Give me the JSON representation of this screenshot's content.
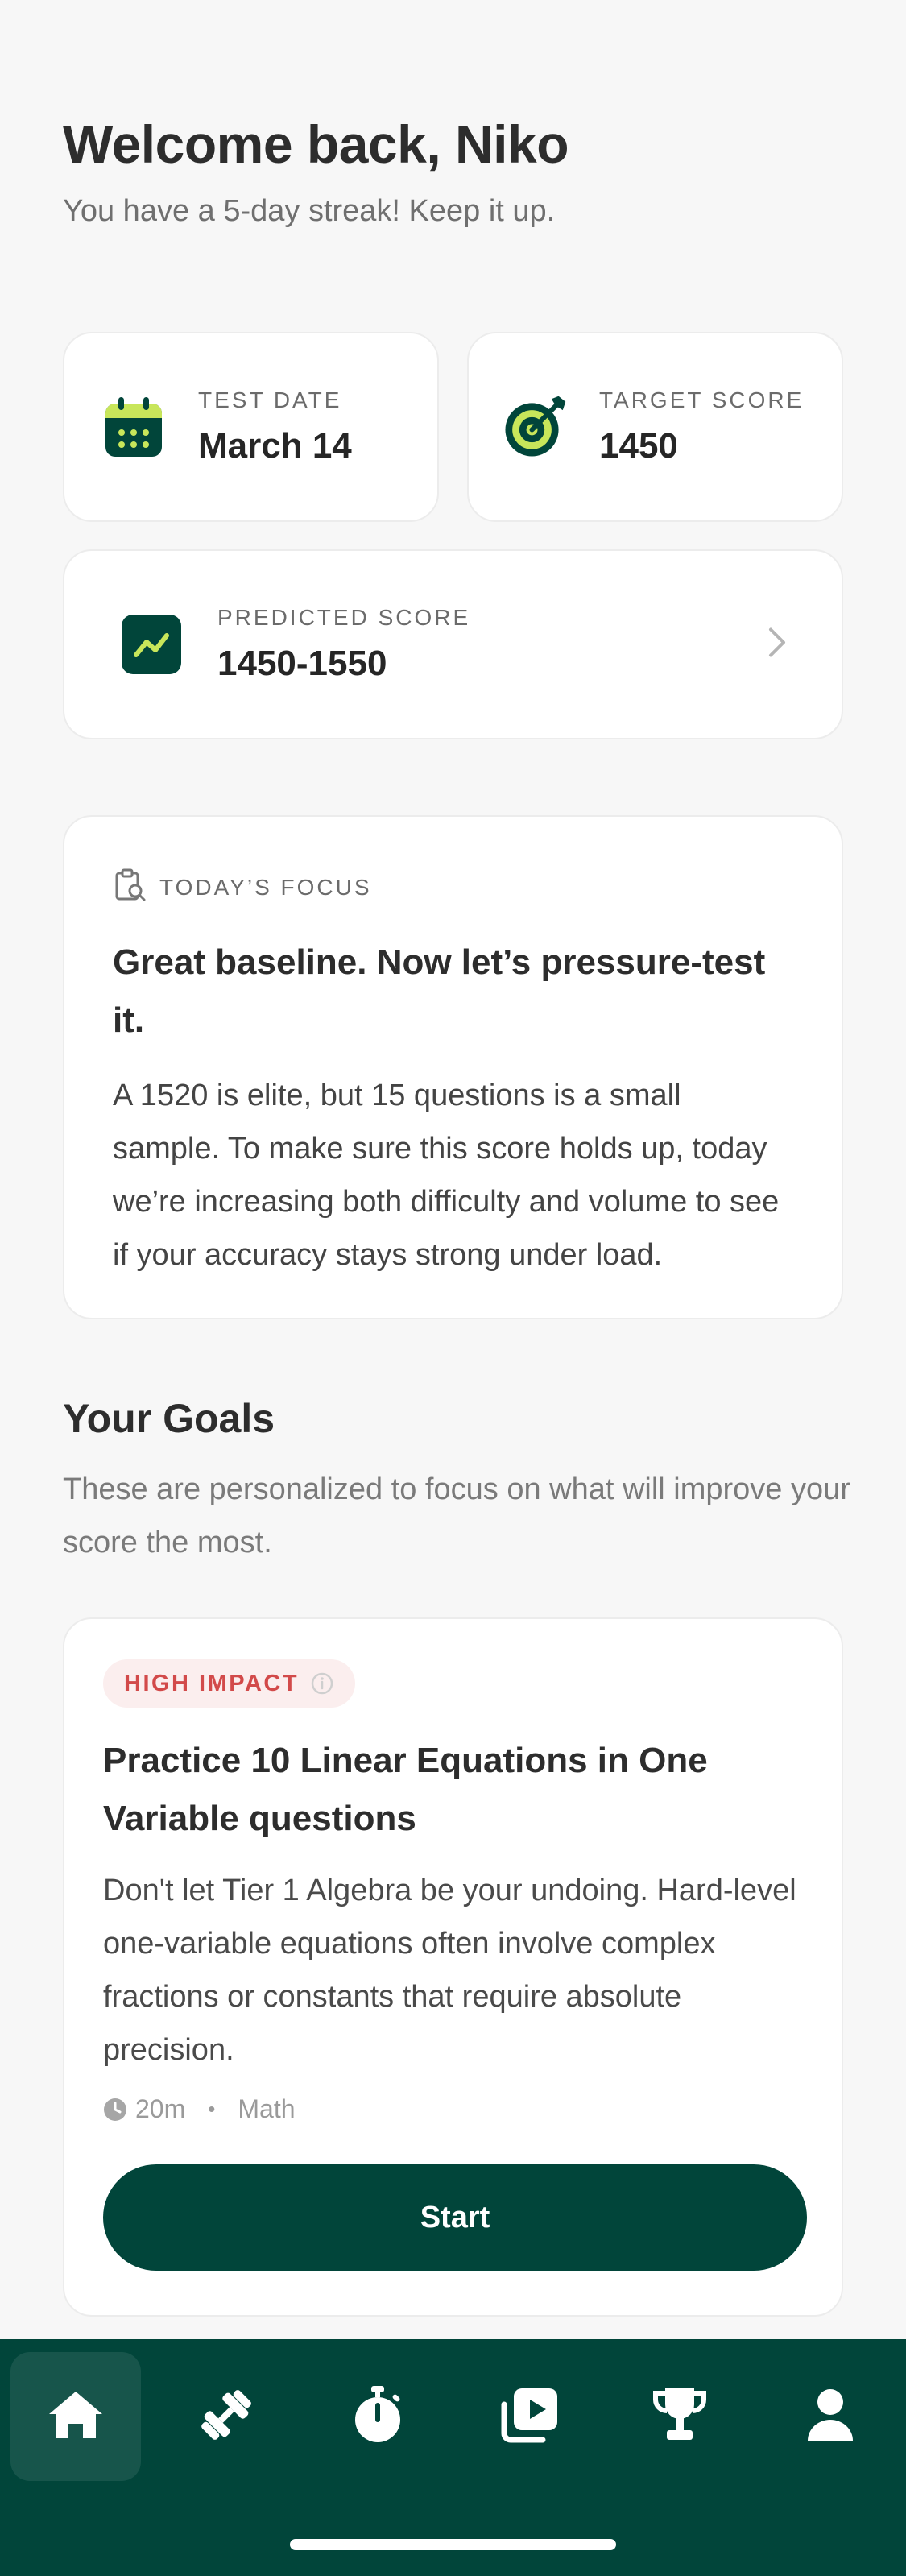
{
  "header": {
    "title": "Welcome back, Niko",
    "subtitle": "You have a 5-day streak! Keep it up."
  },
  "stats": {
    "test_date": {
      "label": "TEST DATE",
      "value": "March 14",
      "icon": "calendar-icon"
    },
    "target_score": {
      "label": "TARGET SCORE",
      "value": "1450",
      "icon": "target-icon"
    },
    "predicted_score": {
      "label": "PREDICTED SCORE",
      "value": "1450-1550",
      "icon": "trend-icon"
    }
  },
  "focus": {
    "label": "TODAY’S FOCUS",
    "title": "Great baseline. Now let’s pressure-test it.",
    "body": "A 1520 is elite, but 15 questions is a small sample. To make sure this score holds up, today we’re increasing both difficulty and volume to see if your accuracy stays strong under load."
  },
  "goals": {
    "title": "Your Goals",
    "subtitle": "These are personalized to focus on what will improve your score the most.",
    "items": [
      {
        "badge": "HIGH IMPACT",
        "title": "Practice 10 Linear Equations in One Variable questions",
        "body": "Don't let Tier 1 Algebra be your undoing. Hard-level one-variable equations often involve complex fractions or constants that require absolute precision.",
        "duration": "20m",
        "subject": "Math",
        "cta": "Start"
      }
    ]
  },
  "tabbar": {
    "items": [
      "home-icon",
      "dumbbell-icon",
      "stopwatch-icon",
      "video-library-icon",
      "trophy-icon",
      "profile-icon"
    ],
    "active": "home-icon"
  },
  "colors": {
    "brand": "#01453a",
    "accent_lime": "#c8e65a",
    "badge_red": "#d24a4a",
    "background": "#f7f7f7"
  }
}
